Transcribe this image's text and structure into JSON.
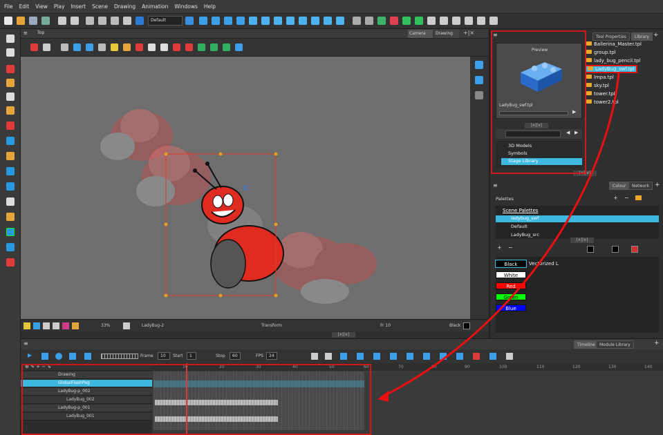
{
  "menu": [
    "File",
    "Edit",
    "View",
    "Play",
    "Insert",
    "Scene",
    "Drawing",
    "Animation",
    "Windows",
    "Help"
  ],
  "toolbar": {
    "workspace": "Default"
  },
  "view": {
    "tab_top": "Top",
    "tab_camera": "Camera",
    "tab_drawing": "Drawing"
  },
  "status": {
    "zoom": "33%",
    "drawing": "LadyBug-2",
    "mode": "Transform",
    "frame": "Fr 10",
    "colour": "Black"
  },
  "library": {
    "tab_tool": "Tool Properties",
    "tab_library": "Library",
    "preview_label": "Preview",
    "preview_name": "LadyBug_swf.tpl",
    "items": [
      "Ballerina_Master.tpl",
      "group.tpl",
      "lady_bug_pencil.tpl",
      "LadyBug_swf.tpl",
      "lmpa.tpl",
      "sky.tpl",
      "tower.tpl",
      "tower2.tpl"
    ],
    "tree": [
      "3D Models",
      "Symbols",
      "Stage Library"
    ]
  },
  "colour": {
    "tab_colour": "Colour",
    "tab_network": "Network",
    "palettes_label": "Palettes",
    "scene_palettes": "Scene Palettes",
    "palettes": [
      "ladybug_swf",
      "Default",
      "LadyBug_src"
    ],
    "swatches": [
      {
        "name": "Black",
        "bg": "#000000",
        "fg": "#ffffff"
      },
      {
        "name": "White",
        "bg": "#ffffff",
        "fg": "#000000"
      },
      {
        "name": "Red",
        "bg": "#ff0000",
        "fg": "#ffffff"
      },
      {
        "name": "Green",
        "bg": "#00ff00",
        "fg": "#000000"
      },
      {
        "name": "Blue",
        "bg": "#0000ff",
        "fg": "#ffffff"
      }
    ],
    "vectorized_label": "Vectorized L"
  },
  "timeline": {
    "tab_timeline": "Timeline",
    "tab_module": "Module Library",
    "frame_label": "Frame",
    "frame": "10",
    "start_label": "Start",
    "start": "1",
    "stop_label": "Stop",
    "stop": "60",
    "fps_label": "FPS",
    "fps": "24",
    "ticks": [
      "10",
      "20",
      "30",
      "40",
      "50",
      "60",
      "70",
      "80",
      "90",
      "100",
      "110",
      "120",
      "130",
      "140"
    ],
    "layers": [
      "Drawing",
      "GlobalFlashPeg",
      "LadyBug-p_002",
      "LadyBug_002",
      "LadyBug-p_001",
      "LadyBug_001"
    ]
  }
}
